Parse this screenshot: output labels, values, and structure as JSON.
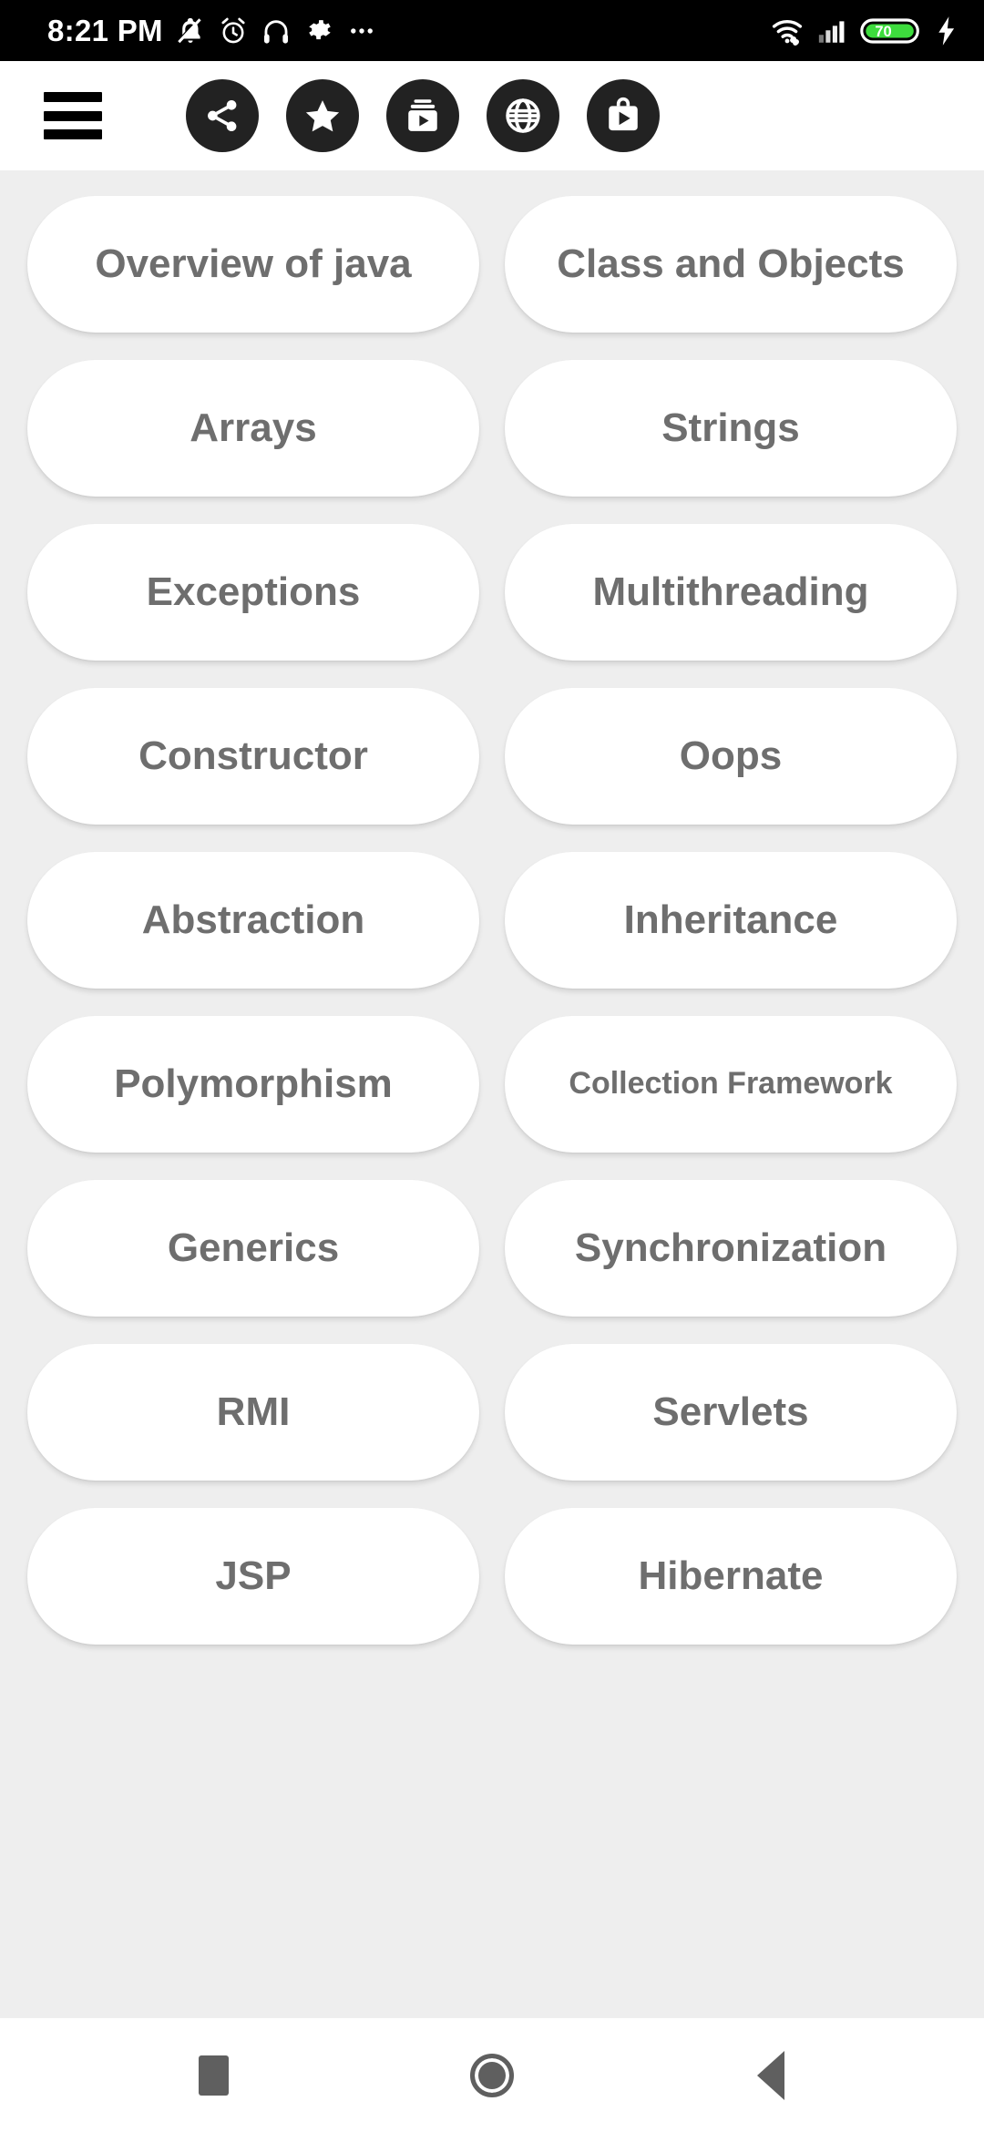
{
  "status_bar": {
    "time": "8:21 PM",
    "battery_level": "70",
    "left_icons": [
      "bell-off-icon",
      "alarm-icon",
      "headphones-icon",
      "gear-icon",
      "more-dots-icon"
    ],
    "right_icons": [
      "wifi-icon",
      "signal-bars-icon",
      "battery-icon",
      "charging-bolt-icon"
    ],
    "colors": {
      "background": "#000000",
      "foreground": "#ffffff",
      "battery_fill": "#3ddc3d"
    }
  },
  "toolbar": {
    "menu_label": "Menu",
    "actions": [
      {
        "name": "share-button",
        "icon": "share-icon"
      },
      {
        "name": "rate-button",
        "icon": "star-icon"
      },
      {
        "name": "video-library-button",
        "icon": "video-library-icon"
      },
      {
        "name": "website-button",
        "icon": "globe-icon"
      },
      {
        "name": "play-store-button",
        "icon": "play-store-bag-icon"
      }
    ],
    "colors": {
      "background": "#ffffff",
      "button_background": "#222222",
      "icon": "#ffffff"
    }
  },
  "main": {
    "topics": [
      {
        "label": "Overview of java",
        "size": "normal"
      },
      {
        "label": "Class and Objects",
        "size": "normal"
      },
      {
        "label": "Arrays",
        "size": "normal"
      },
      {
        "label": "Strings",
        "size": "normal"
      },
      {
        "label": "Exceptions",
        "size": "normal"
      },
      {
        "label": "Multithreading",
        "size": "normal"
      },
      {
        "label": "Constructor",
        "size": "normal"
      },
      {
        "label": "Oops",
        "size": "normal"
      },
      {
        "label": "Abstraction",
        "size": "normal"
      },
      {
        "label": "Inheritance",
        "size": "normal"
      },
      {
        "label": "Polymorphism",
        "size": "normal"
      },
      {
        "label": "Collection Framework",
        "size": "small"
      },
      {
        "label": "Generics",
        "size": "normal"
      },
      {
        "label": "Synchronization",
        "size": "normal"
      },
      {
        "label": "RMI",
        "size": "normal"
      },
      {
        "label": "Servlets",
        "size": "normal"
      },
      {
        "label": "JSP",
        "size": "normal"
      },
      {
        "label": "Hibernate",
        "size": "normal"
      }
    ],
    "colors": {
      "background": "#eeeeee",
      "card": "#ffffff",
      "text": "#6e6e6e"
    }
  },
  "nav_bar": {
    "buttons": [
      {
        "name": "recents-button",
        "icon": "square-icon"
      },
      {
        "name": "home-button",
        "icon": "circle-icon"
      },
      {
        "name": "back-button",
        "icon": "triangle-left-icon"
      }
    ],
    "colors": {
      "background": "#ffffff",
      "icon": "#5f5f5f"
    }
  }
}
